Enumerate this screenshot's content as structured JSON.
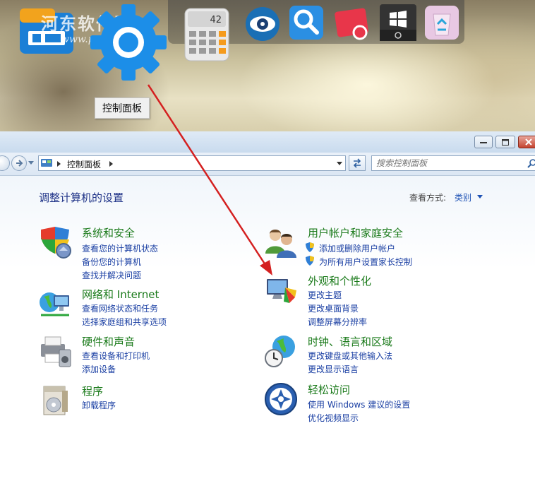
{
  "desktop": {
    "watermark_text": "河东软件园",
    "watermark_url": "www.pc0359.cn",
    "calculator_display": "42",
    "tooltip": "控制面板"
  },
  "window": {
    "breadcrumb": "控制面板",
    "search_placeholder": "搜索控制面板",
    "page_title": "调整计算机的设置",
    "view_by_label": "查看方式:",
    "view_by_value": "类别"
  },
  "categories": {
    "system": {
      "title": "系统和安全",
      "links": [
        "查看您的计算机状态",
        "备份您的计算机",
        "查找并解决问题"
      ]
    },
    "network": {
      "title": "网络和 Internet",
      "links": [
        "查看网络状态和任务",
        "选择家庭组和共享选项"
      ]
    },
    "hardware": {
      "title": "硬件和声音",
      "links": [
        "查看设备和打印机",
        "添加设备"
      ]
    },
    "programs": {
      "title": "程序",
      "links": [
        "卸载程序"
      ]
    },
    "users": {
      "title": "用户帐户和家庭安全",
      "links": [
        "添加或删除用户帐户",
        "为所有用户设置家长控制"
      ]
    },
    "appearance": {
      "title": "外观和个性化",
      "links": [
        "更改主题",
        "更改桌面背景",
        "调整屏幕分辨率"
      ]
    },
    "clock": {
      "title": "时钟、语言和区域",
      "links": [
        "更改键盘或其他输入法",
        "更改显示语言"
      ]
    },
    "ease": {
      "title": "轻松访问",
      "links": [
        "使用 Windows 建议的设置",
        "优化视频显示"
      ]
    }
  },
  "colors": {
    "category_title": "#1a7a1a",
    "link": "#1a3fa3",
    "page_title": "#1e3287",
    "annotation_arrow": "#d42020"
  }
}
